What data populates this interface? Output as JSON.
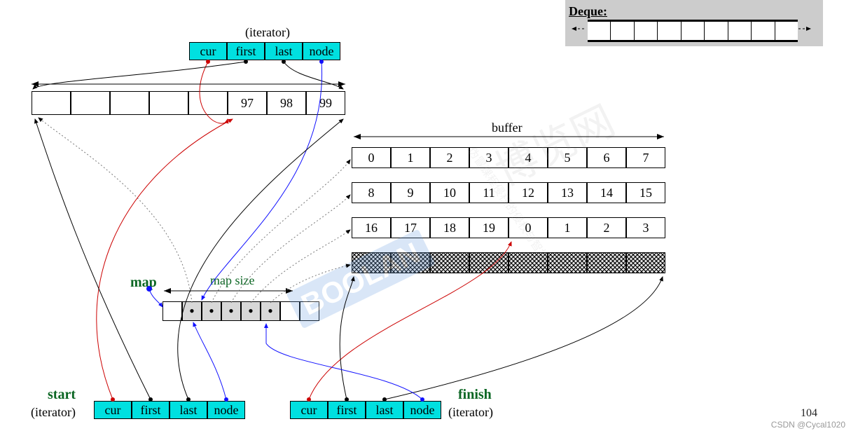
{
  "deque_label": "Deque:",
  "iterator": {
    "title": "(iterator)",
    "fields": [
      "cur",
      "first",
      "last",
      "node"
    ]
  },
  "top_buffer": {
    "visible_values": [
      "97",
      "98",
      "99"
    ],
    "leading_hatched_cells": 5,
    "total_cells": 8
  },
  "buffer_label": "buffer",
  "buffers": [
    [
      "0",
      "1",
      "2",
      "3",
      "4",
      "5",
      "6",
      "7"
    ],
    [
      "8",
      "9",
      "10",
      "11",
      "12",
      "13",
      "14",
      "15"
    ],
    [
      "16",
      "17",
      "18",
      "19",
      "0",
      "1",
      "2",
      "3"
    ]
  ],
  "trailing_hatched_row_cells": 8,
  "map": {
    "label": "map",
    "size_label": "map  size",
    "dot_char": "•",
    "cells": [
      "",
      "•",
      "•",
      "•",
      "•",
      "•",
      "",
      ""
    ],
    "filled_range": [
      1,
      5
    ]
  },
  "start": {
    "label": "start",
    "sub": "(iterator)",
    "fields": [
      "cur",
      "first",
      "last",
      "node"
    ]
  },
  "finish": {
    "label": "finish",
    "sub": "(iterator)",
    "fields": [
      "cur",
      "first",
      "last",
      "node"
    ]
  },
  "watermarks": {
    "brand": "博览网",
    "brand_en": "BOOLAN",
    "side": "伪冒课程侵权的侵权与智权."
  },
  "page_number": "104",
  "credit": "CSDN @Cycal1020",
  "colors": {
    "iter_bg": "#00e0e0",
    "green": "#0b6623"
  }
}
